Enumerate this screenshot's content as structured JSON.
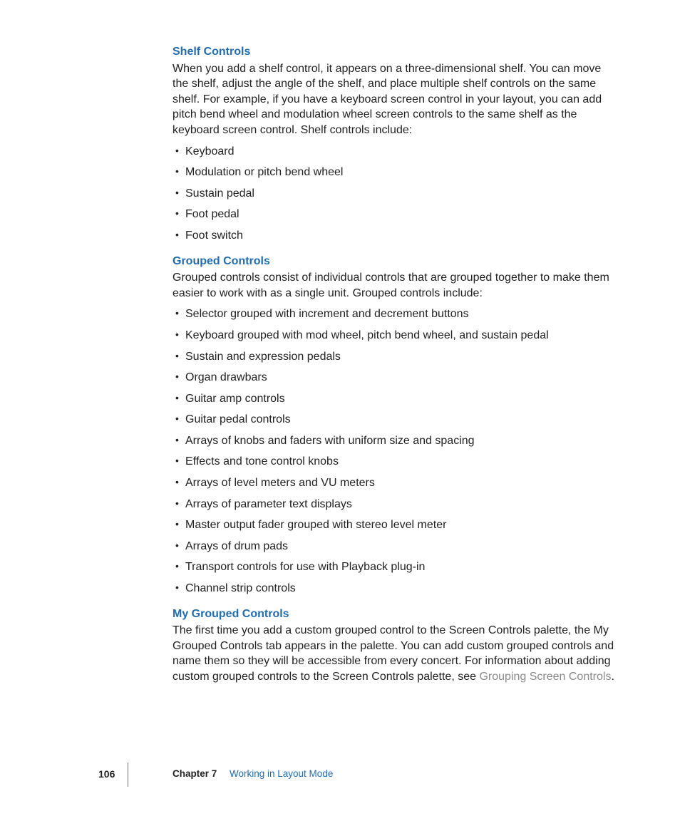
{
  "sections": [
    {
      "heading": "Shelf Controls",
      "para": "When you add a shelf control, it appears on a three-dimensional shelf. You can move the shelf, adjust the angle of the shelf, and place multiple shelf controls on the same shelf. For example, if you have a keyboard screen control in your layout, you can add pitch bend wheel and modulation wheel screen controls to the same shelf as the keyboard screen control. Shelf controls include:",
      "items": [
        "Keyboard",
        "Modulation or pitch bend wheel",
        "Sustain pedal",
        "Foot pedal",
        "Foot switch"
      ]
    },
    {
      "heading": "Grouped Controls",
      "para": "Grouped controls consist of individual controls that are grouped together to make them easier to work with as a single unit. Grouped controls include:",
      "items": [
        "Selector grouped with increment and decrement buttons",
        "Keyboard grouped with mod wheel, pitch bend wheel, and sustain pedal",
        "Sustain and expression pedals",
        "Organ drawbars",
        "Guitar amp controls",
        "Guitar pedal controls",
        "Arrays of knobs and faders with uniform size and spacing",
        "Effects and tone control knobs",
        "Arrays of level meters and VU meters",
        "Arrays of parameter text displays",
        "Master output fader grouped with stereo level meter",
        "Arrays of drum pads",
        "Transport controls for use with Playback plug-in",
        "Channel strip controls"
      ]
    },
    {
      "heading": "My Grouped Controls",
      "para_before_link": "The first time you add a custom grouped control to the Screen Controls palette, the My Grouped Controls tab appears in the palette. You can add custom grouped controls and name them so they will be accessible from every concert. For information about adding custom grouped controls to the Screen Controls palette, see ",
      "link_text": "Grouping Screen Controls",
      "after_link": "."
    }
  ],
  "footer": {
    "page_number": "106",
    "chapter_label": "Chapter 7",
    "chapter_title": "Working in Layout Mode"
  }
}
